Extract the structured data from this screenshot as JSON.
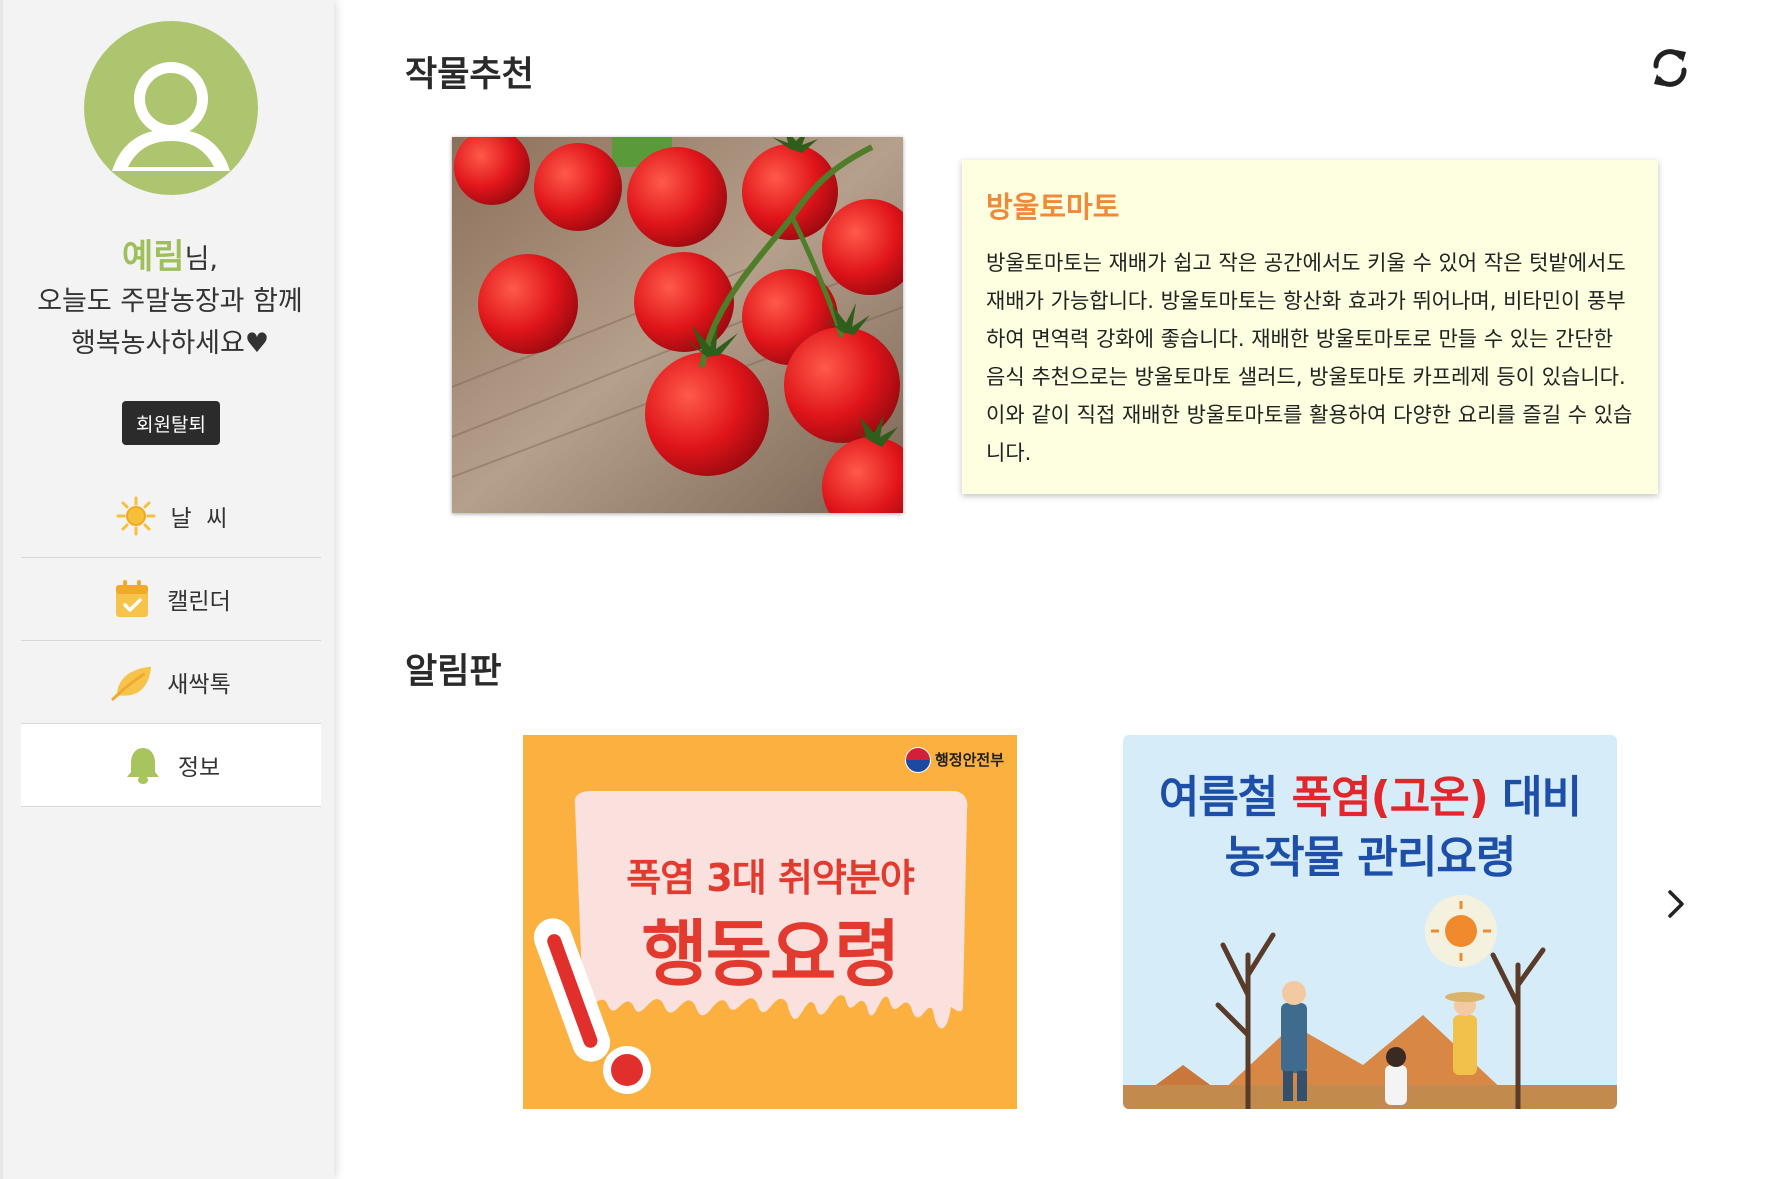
{
  "sidebar": {
    "user_name": "예림",
    "greeting_suffix": "님,",
    "greeting_line2": "오늘도 주말농장과 함께",
    "greeting_line3": "행복농사하세요♥",
    "withdraw_label": "회원탈퇴",
    "nav": [
      {
        "label": "날  씨",
        "icon": "sun-icon"
      },
      {
        "label": "캘린더",
        "icon": "calendar-icon"
      },
      {
        "label": "새싹톡",
        "icon": "leaf-icon"
      },
      {
        "label": "정보",
        "icon": "bell-icon",
        "active": true
      }
    ]
  },
  "crop": {
    "section_title": "작물추천",
    "refresh_icon": "refresh-icon",
    "name": "방울토마토",
    "description": "방울토마토는 재배가 쉽고 작은 공간에서도 키울 수 있어 작은 텃밭에서도 재배가 가능합니다. 방울토마토는 항산화 효과가 뛰어나며, 비타민이 풍부하여 면역력 강화에 좋습니다. 재배한 방울토마토로 만들 수 있는 간단한 음식 추천으로는 방울토마토 샐러드, 방울토마토 카프레제 등이 있습니다. 이와 같이 직접 재배한 방울토마토를 활용하여 다양한 요리를 즐길 수 있습니다."
  },
  "board": {
    "section_title": "알림판",
    "notice1": {
      "agency": "행정안전부",
      "line1": "폭염 3대 취약분야",
      "line2": "행동요령"
    },
    "notice2": {
      "line1_part1": "여름철 ",
      "line1_part2": "폭염(고온)",
      "line1_part3": " 대비",
      "line2": "농작물 관리요령"
    },
    "next_icon": "chevron-right-icon"
  },
  "colors": {
    "accent_green": "#aec56f",
    "title_orange": "#ef8a3a",
    "card_bg": "#fefee0"
  }
}
